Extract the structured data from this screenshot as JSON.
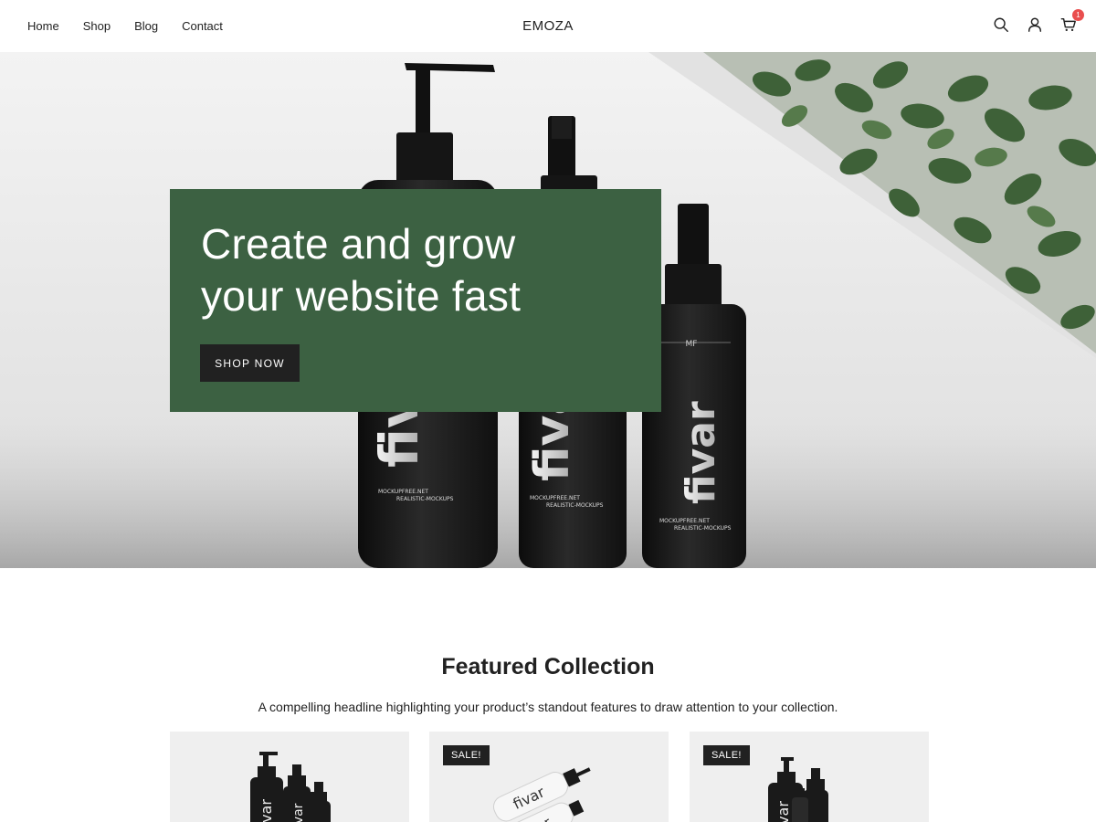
{
  "header": {
    "nav": [
      "Home",
      "Shop",
      "Blog",
      "Contact"
    ],
    "logo": "EMOZA",
    "icons": [
      "search-icon",
      "account-icon",
      "cart-icon"
    ],
    "cart_count": "1"
  },
  "hero": {
    "title_line1": "Create and grow",
    "title_line2": "your website fast",
    "button_label": "SHOP NOW",
    "bottle_brand": "fivar",
    "bottle_tagline1": "MOCKUPFREE.NET",
    "bottle_tagline2": "REALISTIC-MOCKUPS",
    "bottle_monogram": "MF",
    "box_color": "#3c6142"
  },
  "featured": {
    "title": "Featured Collection",
    "subtitle": "A compelling headline highlighting your product’s standout features to draw attention to your collection.",
    "products": [
      {
        "badge": ""
      },
      {
        "badge": "SALE!"
      },
      {
        "badge": "SALE!"
      }
    ]
  },
  "colors": {
    "accent": "#3c6142",
    "dark": "#212121",
    "badge": "#e94e4e"
  }
}
